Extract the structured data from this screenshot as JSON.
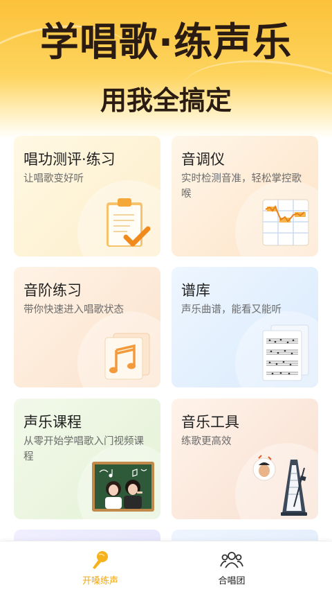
{
  "hero": {
    "title": "学唱歌·练声乐",
    "subtitle": "用我全搞定"
  },
  "cards": [
    {
      "title": "唱功测评·练习",
      "desc": "让唱歌变好听",
      "icon": "clipboard-check-icon"
    },
    {
      "title": "音调仪",
      "desc": "实时检测音准，轻松掌控歌喉",
      "icon": "pitch-graph-icon"
    },
    {
      "title": "音阶练习",
      "desc": "带你快速进入唱歌状态",
      "icon": "music-note-icon"
    },
    {
      "title": "谱库",
      "desc": "声乐曲谱，能看又能听",
      "icon": "sheet-music-icon"
    },
    {
      "title": "声乐课程",
      "desc": "从零开始学唱歌入门视频课程",
      "icon": "chalkboard-singers-image"
    },
    {
      "title": "音乐工具",
      "desc": "练歌更高效",
      "icon": "metronome-icon"
    }
  ],
  "tabbar": {
    "items": [
      {
        "label": "开嗓练声",
        "icon": "microphone-icon",
        "active": true,
        "color": "#f3a60c"
      },
      {
        "label": "合唱团",
        "icon": "group-people-icon",
        "active": false,
        "color": "#222222"
      }
    ]
  }
}
